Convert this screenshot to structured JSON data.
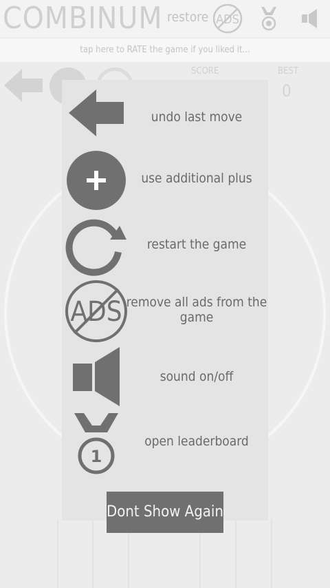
{
  "app": {
    "title": "COMBINUM"
  },
  "header": {
    "restore_label": "restore",
    "ads_icon_text": "ADS"
  },
  "rate_bar": {
    "text": "tap here to RATE the game if you liked it..."
  },
  "scoreboard": {
    "score_label": "SCORE",
    "best_label": "BEST",
    "best_value": "0"
  },
  "help": {
    "items": [
      {
        "icon": "undo-arrow-icon",
        "label": "undo last move"
      },
      {
        "icon": "plus-circle-icon",
        "label": "use additional plus"
      },
      {
        "icon": "restart-icon",
        "label": "restart the game"
      },
      {
        "icon": "no-ads-icon",
        "label": "remove all ads from the game",
        "icon_text": "ADS"
      },
      {
        "icon": "speaker-icon",
        "label": "sound on/off"
      },
      {
        "icon": "medal-icon",
        "label": "open leaderboard",
        "icon_text": "1"
      }
    ],
    "dont_show_label": "Dont Show Again"
  },
  "colors": {
    "background": "#ececec",
    "panel": "#e4e4e4",
    "icon": "#707070",
    "label_text": "#6a6a6a",
    "button_bg": "#707070",
    "button_text": "#f2f2f2"
  }
}
